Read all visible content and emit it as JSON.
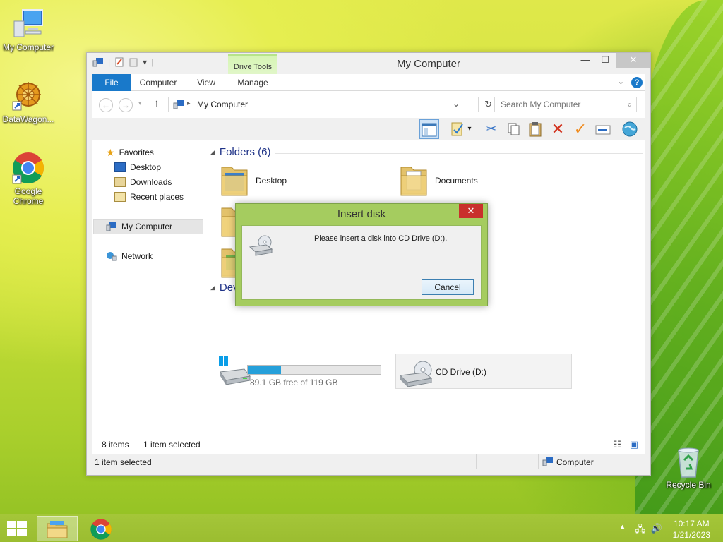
{
  "desktop": {
    "icons": [
      {
        "label": "My Computer"
      },
      {
        "label": "DataWagon..."
      },
      {
        "label": "Google Chrome"
      },
      {
        "label": "Recycle Bin"
      }
    ]
  },
  "window": {
    "title": "My Computer",
    "context_tab_group": "Drive Tools",
    "tabs": [
      "File",
      "Computer",
      "View",
      "Manage"
    ],
    "address_path": "My Computer",
    "search_placeholder": "Search My Computer"
  },
  "nav": {
    "favorites": "Favorites",
    "desktop": "Desktop",
    "downloads": "Downloads",
    "recent": "Recent places",
    "my_computer": "My Computer",
    "network": "Network"
  },
  "main": {
    "folders_header": "Folders (6)",
    "folders": [
      "Desktop",
      "Documents"
    ],
    "devices_header_partial": "Dev",
    "drive_c": {
      "free": "89.1 GB free of 119 GB",
      "used_fraction": 0.25
    },
    "drive_d": {
      "label": "CD Drive (D:)"
    }
  },
  "status": {
    "item_count": "8 items",
    "selected": "1 item selected",
    "bottom_selected": "1 item selected",
    "location": "Computer"
  },
  "dialog": {
    "title": "Insert disk",
    "message": "Please insert a disk into CD Drive (D:).",
    "cancel": "Cancel"
  },
  "taskbar": {
    "time": "10:17 AM",
    "date": "1/21/2023"
  },
  "colors": {
    "accent": "#1979ca",
    "dialog_frame": "#a5cc5f",
    "taskbar": "#a4c639"
  }
}
